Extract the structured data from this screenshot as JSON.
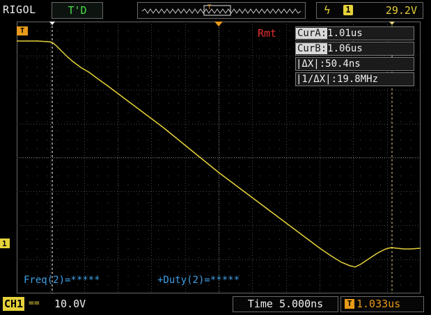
{
  "brand": "RIGOL",
  "trigger_status": "T'D",
  "trigger": {
    "edge_icon": "rising-edge-icon",
    "source": "1",
    "level": "29.2V"
  },
  "markers": {
    "trigger_position": "T",
    "trigger_level": "T",
    "channel_ground": "1"
  },
  "cursor": {
    "mode": "Rmt",
    "cur_a_key": "CurA:",
    "cur_a_value": "1.01us",
    "cur_b_key": "CurB:",
    "cur_b_value": "1.06us",
    "delta_x": "|ΔX|:50.4ns",
    "inv_delta_x": "|1/ΔX|:19.8MHz"
  },
  "measurements": {
    "freq": "Freq(2)=*****",
    "duty": "+Duty(2)=*****"
  },
  "status_bar": {
    "channel_label": "CH1",
    "coupling_icon": "dc-coupling-icon",
    "coupling_glyph": "==",
    "volts_per_div": "10.0V",
    "time_per_div": "Time 5.000ns",
    "offset_icon": "trigger-offset-icon",
    "offset_glyph": "T",
    "horizontal_offset": "1.033us"
  },
  "colors": {
    "trace": "#e6d23a",
    "cursor_line": "#ffffff",
    "trigger_marker": "#e89a1a",
    "measurement_text": "#3ea0e6",
    "remote_text": "#e23030",
    "grid": "#6a6a6a"
  }
}
